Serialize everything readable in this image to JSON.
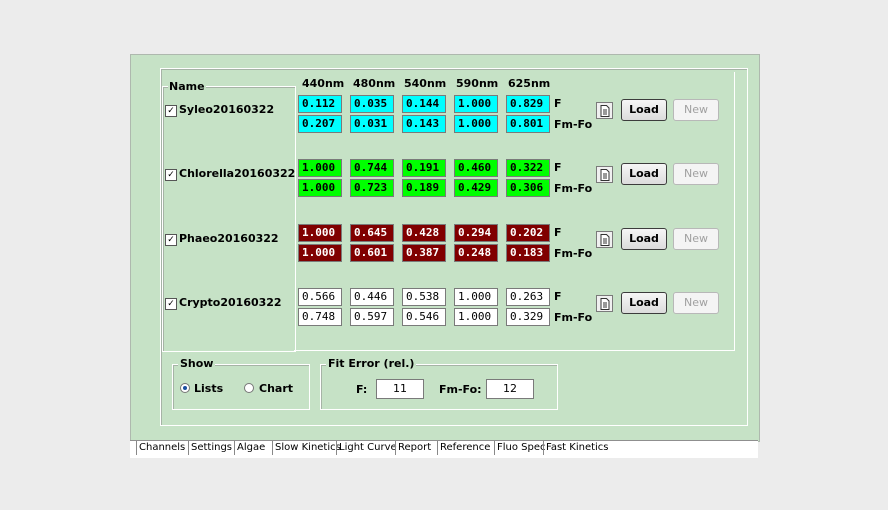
{
  "headers": {
    "name": "Name",
    "wavelengths": [
      "440nm",
      "480nm",
      "540nm",
      "590nm",
      "625nm"
    ]
  },
  "rows": [
    {
      "name": "Syleo20160322",
      "checked": "✓",
      "color": "cyan",
      "f_label": "F",
      "fmfo_label": "Fm-Fo",
      "f": [
        "0.112",
        "0.035",
        "0.144",
        "1.000",
        "0.829"
      ],
      "fmfo": [
        "0.207",
        "0.031",
        "0.143",
        "1.000",
        "0.801"
      ],
      "load": "Load",
      "new": "New",
      "icon": "file-icon"
    },
    {
      "name": "Chlorella20160322",
      "checked": "✓",
      "color": "green",
      "f_label": "F",
      "fmfo_label": "Fm-Fo",
      "f": [
        "1.000",
        "0.744",
        "0.191",
        "0.460",
        "0.322"
      ],
      "fmfo": [
        "1.000",
        "0.723",
        "0.189",
        "0.429",
        "0.306"
      ],
      "load": "Load",
      "new": "New",
      "icon": "file-icon"
    },
    {
      "name": "Phaeo20160322",
      "checked": "✓",
      "color": "red",
      "f_label": "F",
      "fmfo_label": "Fm-Fo",
      "f": [
        "1.000",
        "0.645",
        "0.428",
        "0.294",
        "0.202"
      ],
      "fmfo": [
        "1.000",
        "0.601",
        "0.387",
        "0.248",
        "0.183"
      ],
      "load": "Load",
      "new": "New",
      "icon": "file-icon"
    },
    {
      "name": "Crypto20160322",
      "checked": "✓",
      "color": "white",
      "f_label": "F",
      "fmfo_label": "Fm-Fo",
      "f": [
        "0.566",
        "0.446",
        "0.538",
        "1.000",
        "0.263"
      ],
      "fmfo": [
        "0.748",
        "0.597",
        "0.546",
        "1.000",
        "0.329"
      ],
      "load": "Load",
      "new": "New",
      "icon": "file-icon"
    }
  ],
  "show": {
    "title": "Show",
    "lists": "Lists",
    "chart": "Chart",
    "selected": "Lists"
  },
  "fit_error": {
    "title": "Fit Error (rel.)",
    "f_label": "F:",
    "f_value": "11",
    "fmfo_label": "Fm-Fo:",
    "fmfo_value": "12"
  },
  "tabs": [
    "Channels",
    "Settings",
    "Algae",
    "Slow Kinetics",
    "Light Curve",
    "Report",
    "Reference",
    "Fluo Spec",
    "Fast Kinetics"
  ],
  "active_tab": "Reference",
  "colors": {
    "panel": "#c6e2c6",
    "cyan": "#00ffff",
    "green": "#00ff00",
    "red": "#800000",
    "white": "#ffffff"
  }
}
